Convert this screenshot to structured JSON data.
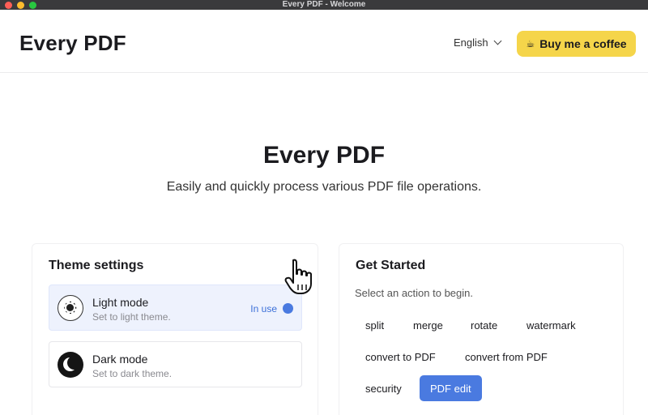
{
  "window": {
    "title": "Every PDF - Welcome"
  },
  "header": {
    "brand": "Every PDF",
    "language": "English",
    "coffee_label": "Buy me a coffee",
    "coffee_icon": "coffee-cup-icon"
  },
  "hero": {
    "title": "Every PDF",
    "subtitle": "Easily and quickly process various PDF file operations."
  },
  "theme": {
    "title": "Theme settings",
    "modes": [
      {
        "name": "Light mode",
        "desc": "Set to light theme.",
        "status": "In use",
        "icon": "sun-icon"
      },
      {
        "name": "Dark mode",
        "desc": "Set to dark theme.",
        "icon": "moon-icon"
      }
    ]
  },
  "start": {
    "title": "Get Started",
    "desc": "Select an action to begin.",
    "actions": [
      "split",
      "merge",
      "rotate",
      "watermark",
      "convert to PDF",
      "convert from PDF",
      "security",
      "PDF edit"
    ]
  },
  "colors": {
    "accent": "#4a7ae0",
    "coffee": "#f5d54a",
    "selected_bg": "#eef2fd"
  }
}
